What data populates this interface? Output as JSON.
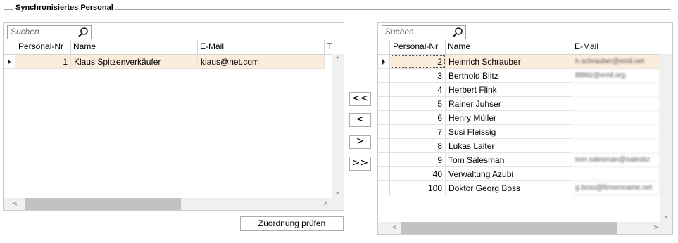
{
  "group": {
    "title": "Synchronisiertes Personal"
  },
  "left_grid": {
    "search_placeholder": "Suchen",
    "columns": [
      "Personal-Nr",
      "Name",
      "E-Mail",
      "T"
    ],
    "rows": [
      {
        "nr": "1",
        "name": "Klaus Spitzenverkäufer",
        "email": "klaus@net.com"
      }
    ]
  },
  "right_grid": {
    "search_placeholder": "Suchen",
    "columns": [
      "Personal-Nr",
      "Name",
      "E-Mail"
    ],
    "rows": [
      {
        "nr": "2",
        "name": "Heinrich Schrauber",
        "email": "h.schrauber@emil.net"
      },
      {
        "nr": "3",
        "name": "Berthold Blitz",
        "email": "BBlitz@emil.org"
      },
      {
        "nr": "4",
        "name": "Herbert Flink",
        "email": ""
      },
      {
        "nr": "5",
        "name": "Rainer Juhser",
        "email": ""
      },
      {
        "nr": "6",
        "name": "Henry Müller",
        "email": ""
      },
      {
        "nr": "7",
        "name": "Susi Fleissig",
        "email": ""
      },
      {
        "nr": "8",
        "name": "Lukas Laiter",
        "email": ""
      },
      {
        "nr": "9",
        "name": "Tom Salesman",
        "email": "tom.salesman@salesbz"
      },
      {
        "nr": "40",
        "name": "Verwaltung Azubi",
        "email": ""
      },
      {
        "nr": "100",
        "name": "Doktor Georg Boss",
        "email": "g.boss@firmenname.net"
      }
    ]
  },
  "transfer_buttons": {
    "move_all_left": "<<",
    "move_left": "<",
    "move_right": ">",
    "move_all_right": ">>"
  },
  "check_button": {
    "label": "Zuordnung prüfen"
  },
  "scroll": {
    "left_arrow": "<",
    "right_arrow": ">",
    "up_arrow": "^",
    "down_arrow": "v"
  }
}
